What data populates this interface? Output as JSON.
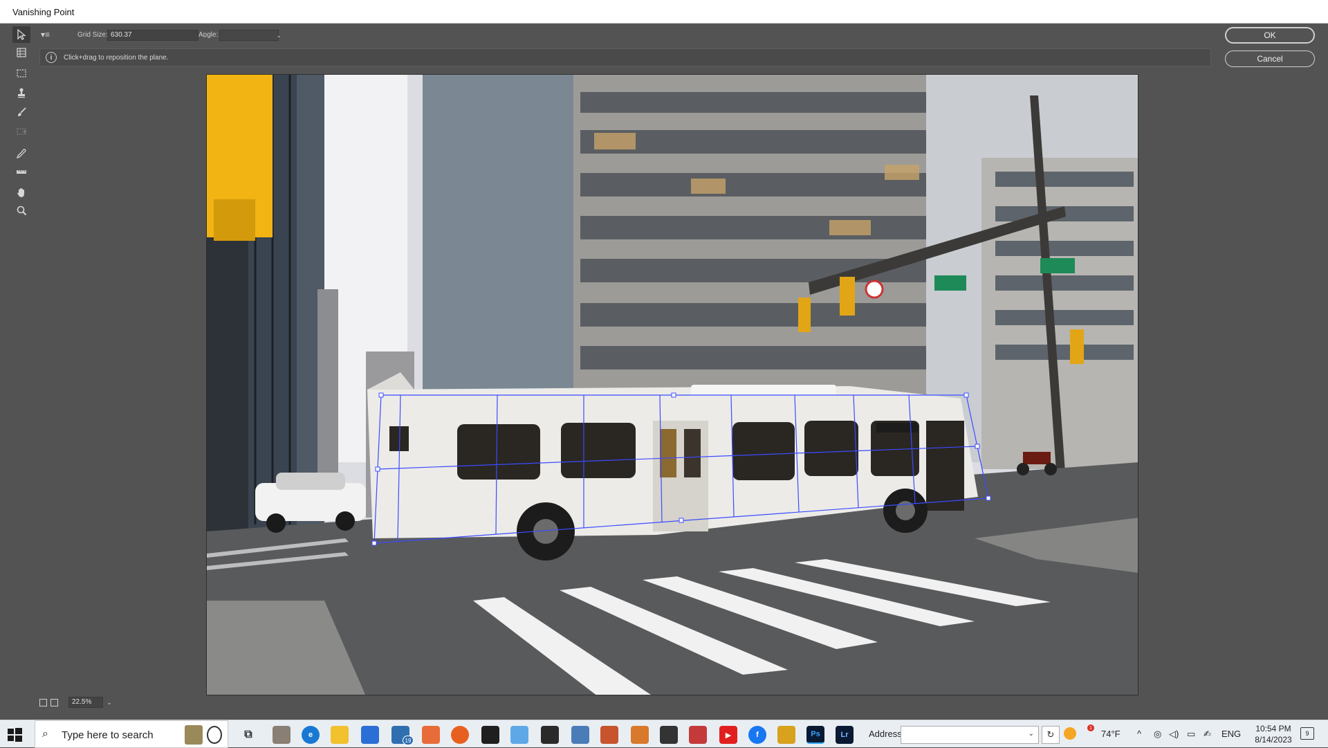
{
  "window": {
    "title": "Vanishing Point"
  },
  "options": {
    "grid_size_label": "Grid Size:",
    "grid_size_value": "630.37",
    "angle_label": "Angle:",
    "angle_value": ""
  },
  "hint": {
    "text": "Click+drag to reposition the plane."
  },
  "buttons": {
    "ok": "OK",
    "cancel": "Cancel"
  },
  "tools": [
    "edit-plane-tool",
    "create-plane-tool",
    "marquee-tool",
    "stamp-tool",
    "brush-tool",
    "transform-tool",
    "eyedropper-tool",
    "measure-tool",
    "hand-tool",
    "zoom-tool"
  ],
  "footer": {
    "zoom": "22.5%"
  },
  "taskbar": {
    "search_placeholder": "Type here to search",
    "mail_badge": "19",
    "ps_label": "Ps",
    "lr_label": "Lr",
    "address_label": "Address",
    "weather": "74°F",
    "weather_badge": "1",
    "language": "ENG",
    "time": "10:54 PM",
    "date": "8/14/2023",
    "notification_count": "9"
  },
  "colors": {
    "accent_grid": "#3b4bff",
    "dialog_bg": "#535353",
    "taskbar_bg": "#e9eef3"
  }
}
